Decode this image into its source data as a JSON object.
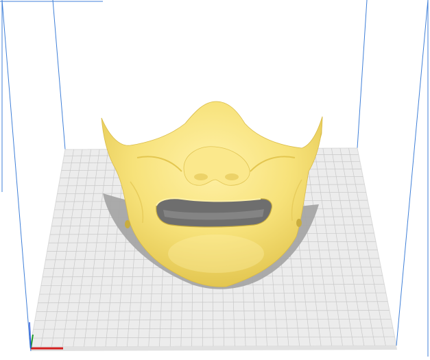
{
  "scene": {
    "background_color": "#ffffff",
    "build_plate": {
      "surface_color": "#ececec",
      "grid_color": "#c8c8c8",
      "edge_color": "#d9d9d9"
    },
    "build_volume": {
      "edge_color": "#3f7fd8"
    },
    "axes": {
      "x_color": "#d42020",
      "y_color": "#1f9c2a",
      "z_color": "#2a56d8"
    },
    "model": {
      "name_icon": "mask-model",
      "base_color": "#f7e27a",
      "highlight_color": "#fff1a8",
      "shade_color": "#e3c650",
      "cavity_color": "#6e6e6e",
      "shadow_color": "#a3a3a3"
    }
  }
}
